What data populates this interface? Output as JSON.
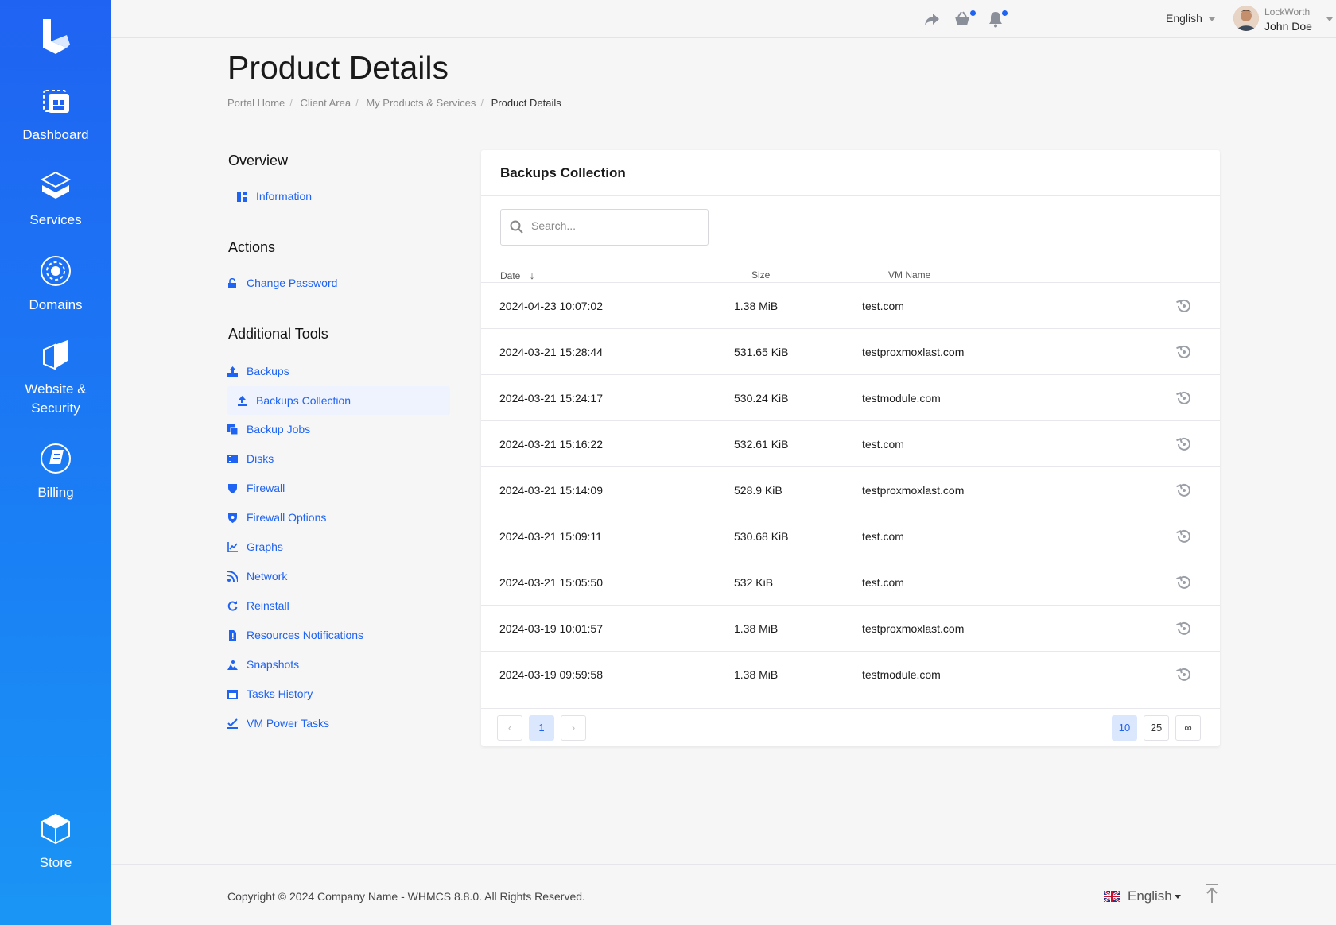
{
  "sidebar": {
    "items": [
      {
        "label": "Dashboard",
        "icon": "dashboard-icon"
      },
      {
        "label": "Services",
        "icon": "services-icon"
      },
      {
        "label": "Domains",
        "icon": "domains-icon"
      },
      {
        "label": "Website &",
        "label2": "Security",
        "icon": "website-security-icon"
      },
      {
        "label": "Billing",
        "icon": "billing-icon"
      }
    ],
    "store_label": "Store"
  },
  "topbar": {
    "language": "English",
    "user_company": "LockWorth",
    "user_name": "John Doe"
  },
  "header": {
    "title": "Product Details",
    "breadcrumb": [
      "Portal Home",
      "Client Area",
      "My Products & Services",
      "Product Details"
    ]
  },
  "menu": {
    "overview_title": "Overview",
    "information": "Information",
    "actions_title": "Actions",
    "change_password": "Change Password",
    "tools_title": "Additional Tools",
    "tools": [
      "Backups",
      "Backups Collection",
      "Backup Jobs",
      "Disks",
      "Firewall",
      "Firewall Options",
      "Graphs",
      "Network",
      "Reinstall",
      "Resources Notifications",
      "Snapshots",
      "Tasks History",
      "VM Power Tasks"
    ]
  },
  "panel": {
    "title": "Backups Collection",
    "search_placeholder": "Search...",
    "columns": {
      "date": "Date",
      "size": "Size",
      "vm": "VM Name"
    },
    "rows": [
      {
        "date": "2024-04-23 10:07:02",
        "size": "1.38 MiB",
        "vm": "test.com"
      },
      {
        "date": "2024-03-21 15:28:44",
        "size": "531.65 KiB",
        "vm": "testproxmoxlast.com"
      },
      {
        "date": "2024-03-21 15:24:17",
        "size": "530.24 KiB",
        "vm": "testmodule.com"
      },
      {
        "date": "2024-03-21 15:16:22",
        "size": "532.61 KiB",
        "vm": "test.com"
      },
      {
        "date": "2024-03-21 15:14:09",
        "size": "528.9 KiB",
        "vm": "testproxmoxlast.com"
      },
      {
        "date": "2024-03-21 15:09:11",
        "size": "530.68 KiB",
        "vm": "test.com"
      },
      {
        "date": "2024-03-21 15:05:50",
        "size": "532 KiB",
        "vm": "test.com"
      },
      {
        "date": "2024-03-19 10:01:57",
        "size": "1.38 MiB",
        "vm": "testproxmoxlast.com"
      },
      {
        "date": "2024-03-19 09:59:58",
        "size": "1.38 MiB",
        "vm": "testmodule.com"
      }
    ],
    "pagination": {
      "prev": "‹",
      "current": "1",
      "next": "›"
    },
    "page_sizes": [
      "10",
      "25",
      "∞"
    ]
  },
  "footer": {
    "copyright": "Copyright © 2024 Company Name - WHMCS 8.8.0. All Rights Reserved.",
    "language": "English"
  },
  "colors": {
    "accent": "#1f63f2",
    "sidebar_top": "#1f63f2",
    "sidebar_bottom": "#1a95f5"
  }
}
